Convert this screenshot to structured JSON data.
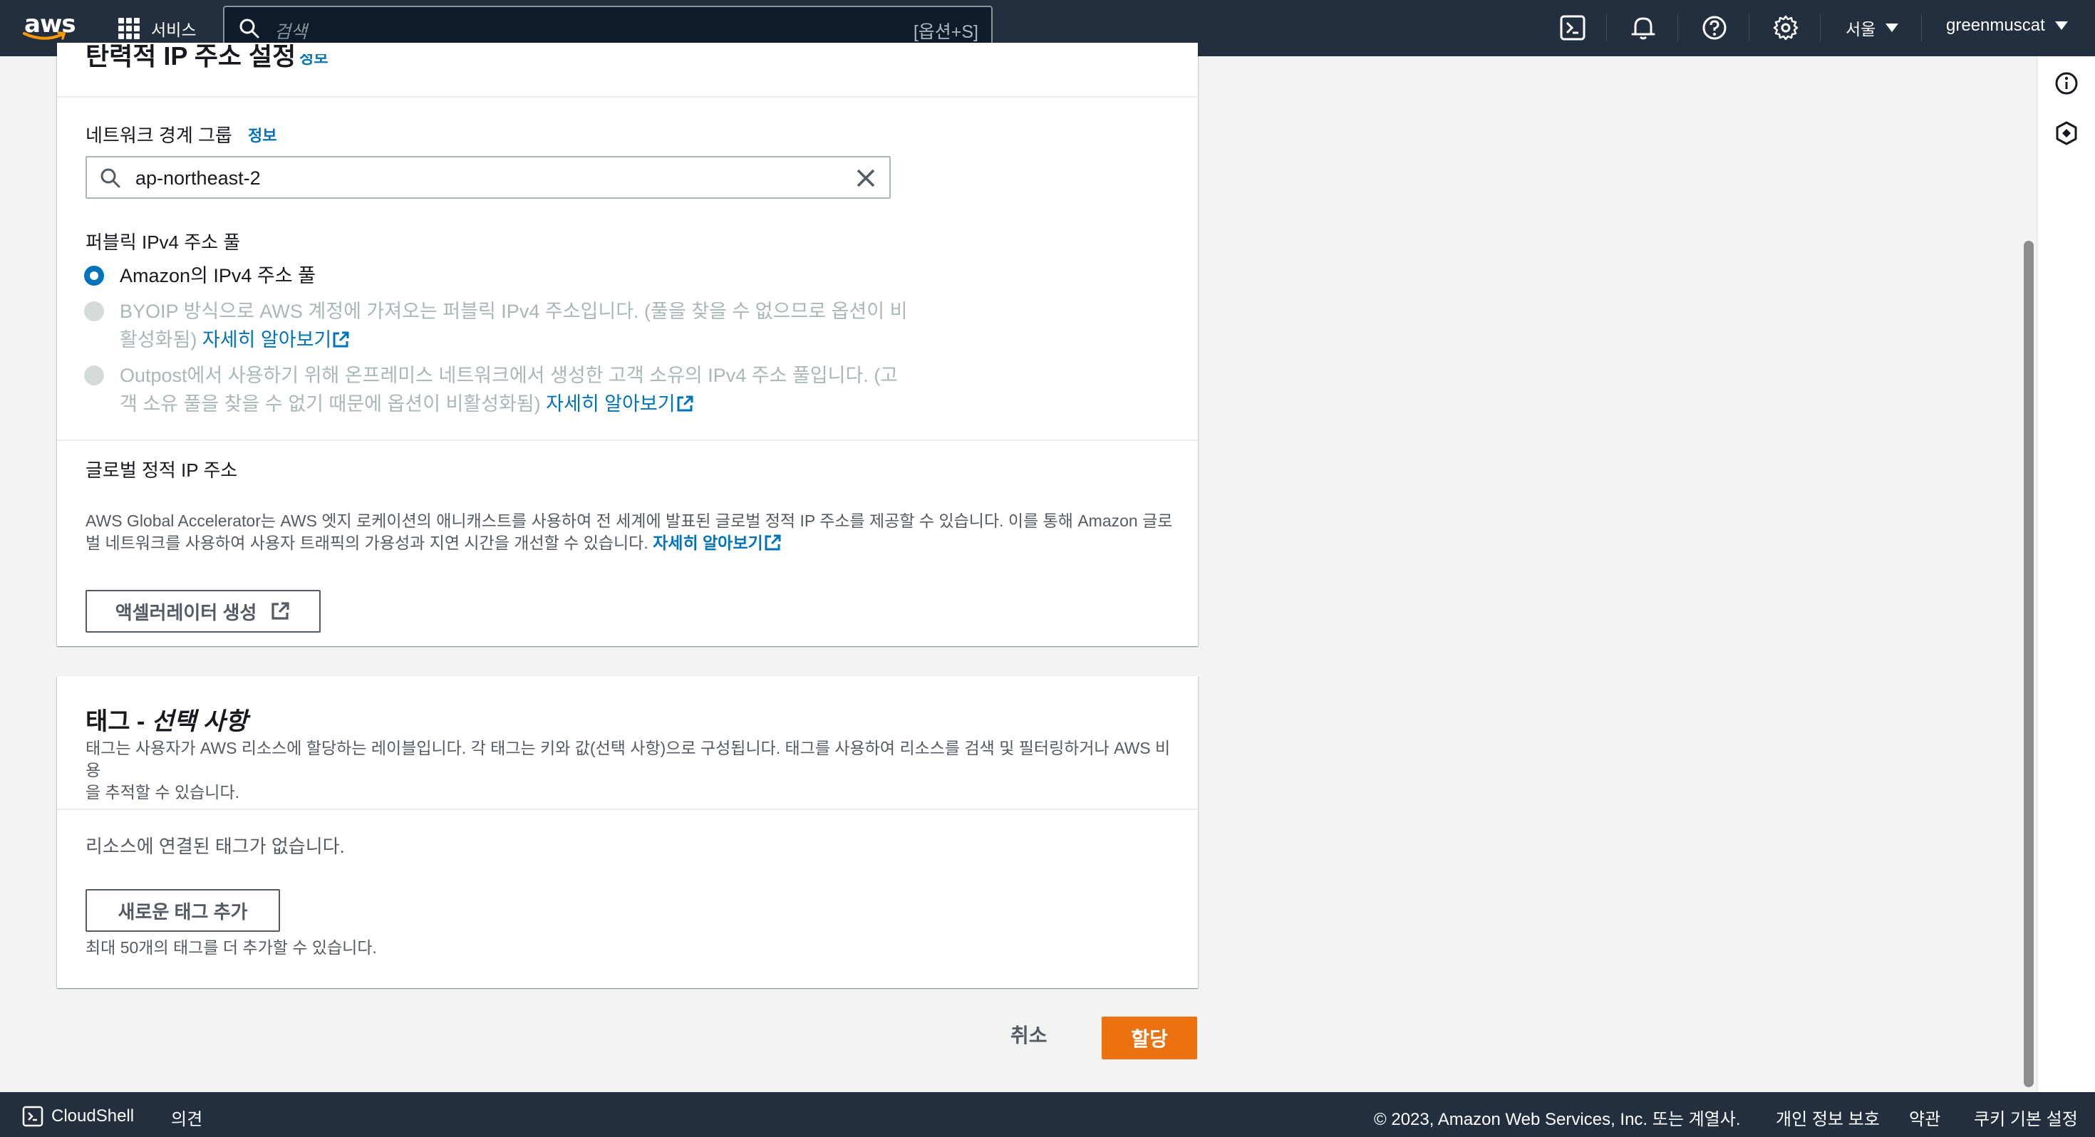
{
  "topnav": {
    "logo_text": "aws",
    "services_label": "서비스",
    "search_placeholder": "검색",
    "search_shortcut": "[옵션+S]",
    "icons": [
      "cloudshell-icon",
      "bell-icon",
      "help-icon",
      "settings-icon"
    ],
    "region": "서울",
    "account": "greenmuscat"
  },
  "panel1": {
    "partial_heading": "탄력적 IP 주소 설정",
    "partial_info": "정보",
    "network_border_group_label": "네트워크 경계 그룹",
    "network_border_group_info": "정보",
    "network_border_group_value": "ap-northeast-2",
    "pool_label": "퍼블릭 IPv4 주소 풀",
    "options": {
      "amazon": "Amazon의 IPv4 주소 풀",
      "byoip_line1": "BYOIP 방식으로 AWS 계정에 가져오는 퍼블릭 IPv4 주소입니다. (풀을 찾을 수 없으므로 옵션이 비",
      "byoip_line2": "활성화됨)",
      "byoip_link": "자세히 알아보기",
      "outpost_line1": "Outpost에서 사용하기 위해 온프레미스 네트워크에서 생성한 고객 소유의 IPv4 주소 풀입니다. (고",
      "outpost_line2": "객 소유 풀을 찾을 수 없기 때문에 옵션이 비활성화됨)",
      "outpost_link": "자세히 알아보기"
    },
    "global_ip_label": "글로벌 정적 IP 주소",
    "global_desc_line1": "AWS Global Accelerator는 AWS 엣지 로케이션의 애니캐스트를 사용하여 전 세계에 발표된 글로벌 정적 IP 주소를 제공할 수 있습니다. 이를 통해 Amazon 글로",
    "global_desc_line2": "벌 네트워크를 사용하여 사용자 트래픽의 가용성과 지연 시간을 개선할 수 있습니다.",
    "global_desc_link": "자세히 알아보기",
    "accelerator_button": "액셀러레이터 생성"
  },
  "panel2": {
    "title_main": "태그 - ",
    "title_optional": "선택 사항",
    "desc_line1": "태그는 사용자가 AWS 리소스에 할당하는 레이블입니다. 각 태그는 키와 값(선택 사항)으로 구성됩니다. 태그를 사용하여 리소스를 검색 및 필터링하거나 AWS 비용",
    "desc_line2": "을 추적할 수 있습니다.",
    "no_tags": "리소스에 연결된 태그가 없습니다.",
    "add_tag_button": "새로운 태그 추가",
    "limit_hint": "최대 50개의 태그를 더 추가할 수 있습니다."
  },
  "actions": {
    "cancel": "취소",
    "allocate": "할당"
  },
  "bottombar": {
    "cloudshell": "CloudShell",
    "feedback": "의견",
    "copyright": "© 2023, Amazon Web Services, Inc. 또는 계열사.",
    "privacy": "개인 정보 보호",
    "terms": "약관",
    "cookie": "쿠키 기본 설정"
  },
  "colors": {
    "nav_bg": "#232f3e",
    "link": "#0073bb",
    "primary": "#ec7211",
    "page_bg": "#f2f3f3"
  }
}
